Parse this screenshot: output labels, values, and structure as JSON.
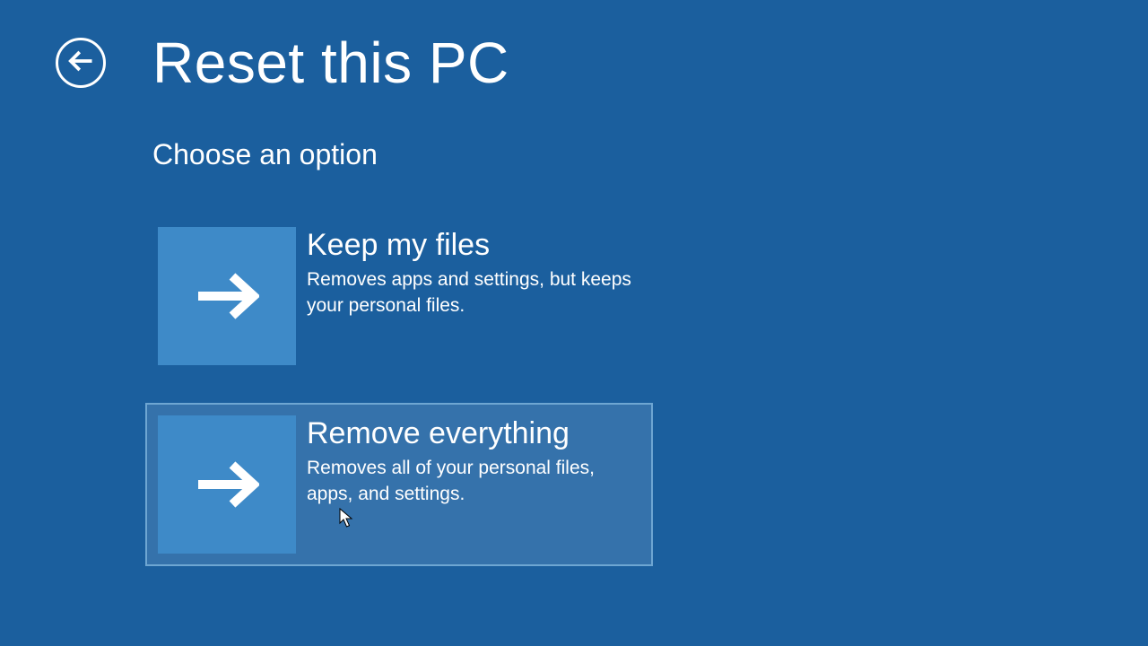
{
  "header": {
    "title": "Reset this PC"
  },
  "subtitle": "Choose an option",
  "options": [
    {
      "title": "Keep my files",
      "description": "Removes apps and settings, but keeps your personal files.",
      "hovered": false
    },
    {
      "title": "Remove everything",
      "description": "Removes all of your personal files, apps, and settings.",
      "hovered": true
    }
  ],
  "colors": {
    "background": "#1b5f9e",
    "tile": "#3e8ac8",
    "hover": "#3572ab"
  }
}
